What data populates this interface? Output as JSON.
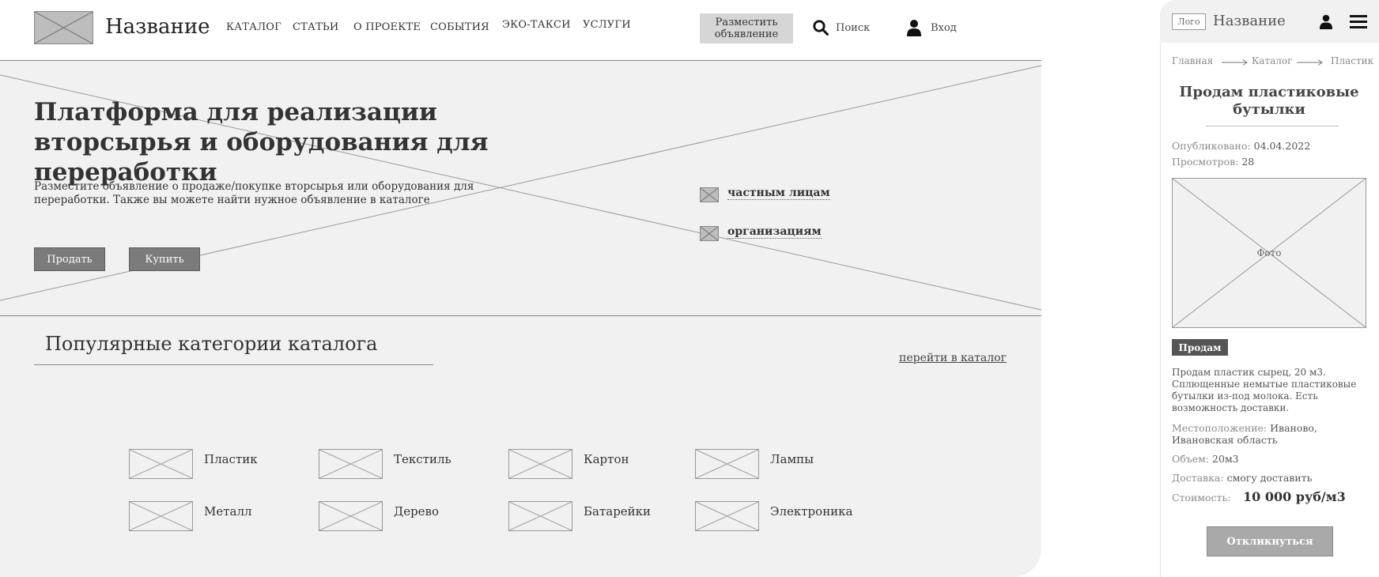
{
  "header": {
    "site_name": "Название",
    "nav": [
      "КАТАЛОГ",
      "СТАТЬИ",
      "О ПРОЕКТЕ",
      "СОБЫТИЯ",
      "ЭКО-ТАКСИ",
      "УСЛУГИ"
    ],
    "post_ad_label": "Разместить объявление",
    "search_label": "Поиск",
    "login_label": "Вход"
  },
  "hero": {
    "title": "Платформа для реализации вторсырья и оборудования для переработки",
    "description": "Разместите объявление о продаже/покупке вторсырья или оборудования для переработки. Также вы можете найти нужное объявление в каталоге",
    "sell_label": "Продать",
    "buy_label": "Купить",
    "audience": [
      "частным лицам",
      "организациям"
    ]
  },
  "categories": {
    "title": "Популярные категории каталога",
    "catalog_link": "перейти в каталог",
    "items": [
      "Пластик",
      "Текстиль",
      "Картон",
      "Лампы",
      "Металл",
      "Дерево",
      "Батарейки",
      "Электроника"
    ]
  },
  "mobile": {
    "logo": "Лого",
    "site_name": "Название",
    "breadcrumbs": [
      "Главная",
      "Каталог",
      "Пластик"
    ],
    "title": "Продам пластиковые бутылки",
    "published_label": "Опубликовано:",
    "published_value": "04.04.2022",
    "views_label": "Просмотров:",
    "views_value": "28",
    "photo_label": "Фото",
    "tag": "Продам",
    "description": "Продам пластик сырец, 20 м3. Сплющенные немытые пластиковые бутылки из-под молока. Есть возможность доставки.",
    "location_label": "Местоположение:",
    "location_value": "Иваново, Ивановская область",
    "volume_label": "Объем:",
    "volume_value": "20м3",
    "delivery_label": "Доставка:",
    "delivery_value": "смогу доставить",
    "price_label": "Стоимость:",
    "price_value": "10 000 руб/м3",
    "respond_label": "Откликнуться"
  },
  "colors": {
    "hero_bg": "#f1f1f1",
    "placeholder": "#bdbdbd",
    "button_dark": "#7b7b7b",
    "tag_bg": "#555555"
  }
}
